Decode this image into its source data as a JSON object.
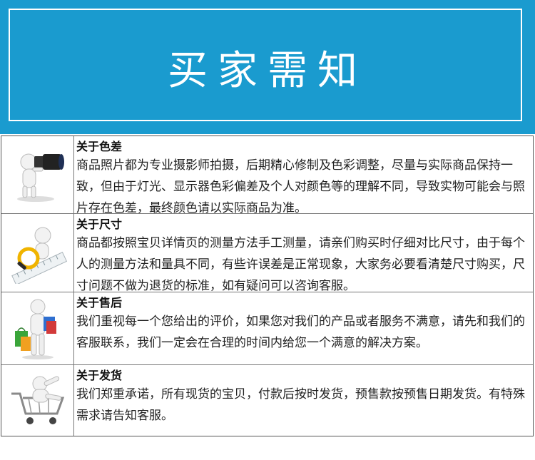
{
  "banner": {
    "title": "买家需知",
    "bg_color": "#1a9bcf"
  },
  "sections": [
    {
      "icon": "photographer-figure-icon",
      "title": "关于色差",
      "body": "商品照片都为专业摄影师拍摄，后期精心修制及色彩调整，尽量与实际商品保持一致，但由于灯光、显示器色彩偏差及个人对颜色等的理解不同，导致实物可能会与照片存在色差，最终颜色请以实际商品为准。"
    },
    {
      "icon": "magnifier-ruler-figure-icon",
      "title": "关于尺寸",
      "body": "商品都按照宝贝详情页的测量方法手工测量，请亲们购买时仔细对比尺寸，由于每个人的测量方法和量具不同，有些许误差是正常现象，大家务必要看清楚尺寸购买，尺寸问题不做为退货的标准，如有疑问可以咨询客服。"
    },
    {
      "icon": "shopping-bags-figure-icon",
      "title": "关于售后",
      "body": "我们重视每一个您给出的评价，如果您对我们的产品或者服务不满意，请先和我们的客服联系，我们一定会在合理的时间内给您一个满意的解决方案。"
    },
    {
      "icon": "shopping-cart-figure-icon",
      "title": "关于发货",
      "body": "我们郑重承诺，所有现货的宝贝，付款后按时发货，预售款按预售日期发货。有特殊需求请告知客服。"
    }
  ]
}
